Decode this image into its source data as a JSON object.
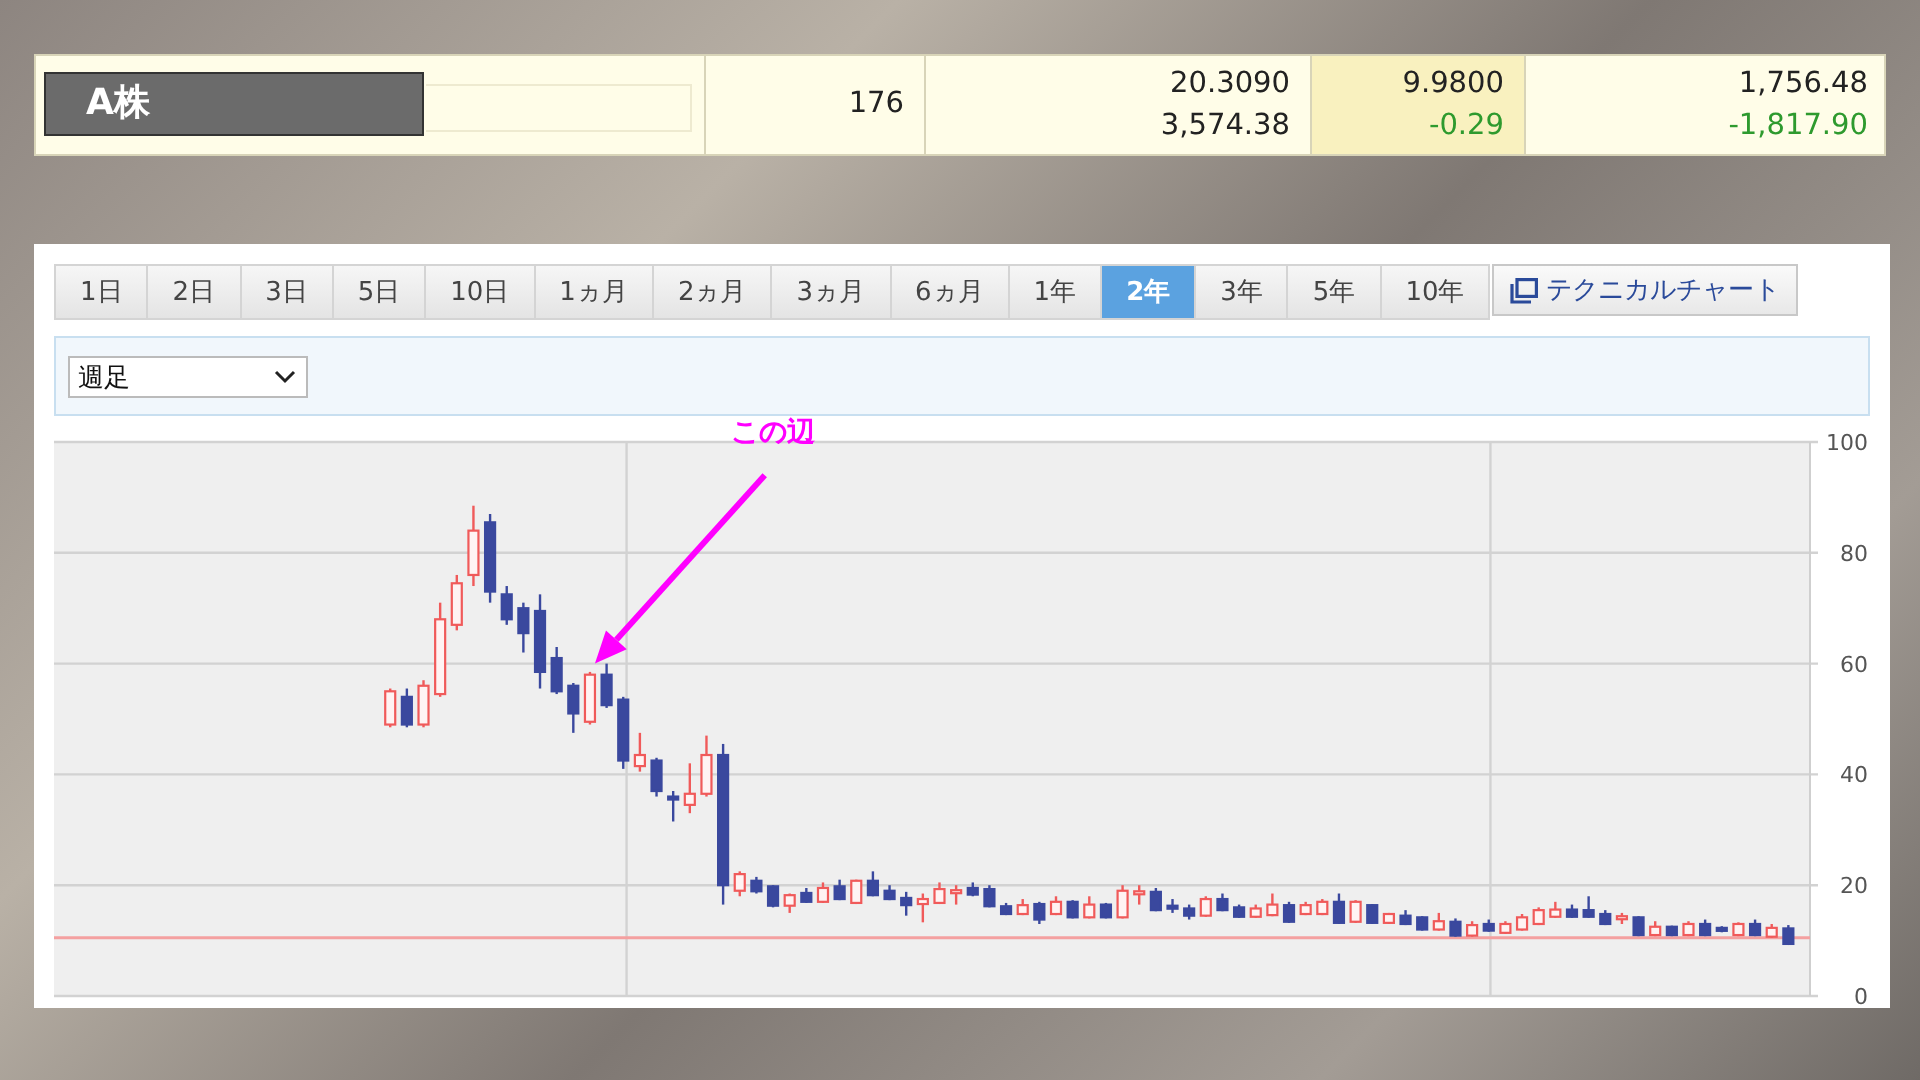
{
  "quote": {
    "name": "A株",
    "cells": [
      {
        "value": "176",
        "highlighted": false
      },
      {
        "value": "20.3090",
        "sub": "3,574.38",
        "highlighted": false
      },
      {
        "value": "9.9800",
        "change": "-0.29",
        "highlighted": true
      },
      {
        "value": "1,756.48",
        "change": "-1,817.90",
        "highlighted": false
      }
    ]
  },
  "period_tabs": [
    {
      "label": "1日",
      "selected": false
    },
    {
      "label": "2日",
      "selected": false
    },
    {
      "label": "3日",
      "selected": false
    },
    {
      "label": "5日",
      "selected": false
    },
    {
      "label": "10日",
      "selected": false
    },
    {
      "label": "1ヵ月",
      "selected": false
    },
    {
      "label": "2ヵ月",
      "selected": false
    },
    {
      "label": "3ヵ月",
      "selected": false
    },
    {
      "label": "6ヵ月",
      "selected": false
    },
    {
      "label": "1年",
      "selected": false
    },
    {
      "label": "2年",
      "selected": true
    },
    {
      "label": "3年",
      "selected": false
    },
    {
      "label": "5年",
      "selected": false
    },
    {
      "label": "10年",
      "selected": false
    }
  ],
  "technical_chart_button": {
    "label": "テクニカルチャート"
  },
  "interval_select": {
    "value": "週足"
  },
  "chart": {
    "chart_data": {
      "type": "candlestick",
      "ylim": [
        0,
        100
      ],
      "yticks": [
        0,
        20,
        40,
        60,
        80,
        100
      ],
      "grid": true,
      "annotations": [
        "この辺"
      ],
      "ohlc": [
        [
          49,
          55.5,
          48.5,
          55
        ],
        [
          54,
          55.5,
          48.5,
          49
        ],
        [
          49,
          57,
          48.5,
          56
        ],
        [
          54.5,
          71,
          54,
          68
        ],
        [
          67,
          76,
          66,
          74.5
        ],
        [
          76,
          88.5,
          74,
          84
        ],
        [
          85.5,
          87,
          71,
          73
        ],
        [
          72.5,
          74,
          67,
          68
        ],
        [
          70,
          71,
          62,
          65.5
        ],
        [
          69.5,
          72.5,
          55.5,
          58.5
        ],
        [
          61,
          63,
          54.5,
          55
        ],
        [
          56,
          56.5,
          47.5,
          51
        ],
        [
          49.5,
          58.5,
          49,
          58
        ],
        [
          58,
          60,
          52,
          52.5
        ],
        [
          53.5,
          54,
          41,
          42.5
        ],
        [
          41.5,
          47.5,
          40.5,
          43.5
        ],
        [
          42.5,
          43,
          36,
          37
        ],
        [
          36,
          37,
          31.5,
          35.5
        ],
        [
          34.5,
          42,
          33,
          36.5
        ],
        [
          36.5,
          47,
          36,
          43.5
        ],
        [
          43.5,
          45.5,
          16.5,
          20
        ],
        [
          19,
          22.5,
          18,
          22
        ],
        [
          20.8,
          21.5,
          18.5,
          18.9
        ],
        [
          19.8,
          20,
          16,
          16.3
        ],
        [
          16.3,
          18.5,
          15,
          18.2
        ],
        [
          18.6,
          19.5,
          16.8,
          17
        ],
        [
          17,
          20.5,
          16.8,
          19.5
        ],
        [
          19.8,
          21,
          17.3,
          17.5
        ],
        [
          16.8,
          21,
          16.6,
          20.8
        ],
        [
          20.8,
          22.5,
          18,
          18.2
        ],
        [
          19,
          20,
          17.3,
          17.5
        ],
        [
          17.7,
          18.8,
          14.5,
          16.4
        ],
        [
          16.6,
          18.5,
          13.3,
          17.5
        ],
        [
          16.8,
          20.5,
          16.6,
          19.3
        ],
        [
          18.8,
          20,
          16.5,
          19.1
        ],
        [
          19.5,
          20.5,
          18,
          18.3
        ],
        [
          19.3,
          20,
          16,
          16.2
        ],
        [
          16.2,
          16.8,
          14.6,
          14.8
        ],
        [
          14.8,
          17.5,
          14.6,
          16.4
        ],
        [
          16.6,
          17,
          13,
          13.8
        ],
        [
          14.8,
          18,
          14.6,
          17
        ],
        [
          17,
          17.3,
          14,
          14.2
        ],
        [
          14.2,
          18,
          14,
          16.5
        ],
        [
          16.5,
          16.8,
          14,
          14.2
        ],
        [
          14.2,
          20,
          14,
          19
        ],
        [
          18.5,
          20,
          16.5,
          18.9
        ],
        [
          18.8,
          19.5,
          15.3,
          15.5
        ],
        [
          16.3,
          17.5,
          15,
          15.8
        ],
        [
          15.8,
          16.5,
          13.8,
          14.5
        ],
        [
          14.5,
          18,
          14.3,
          17.5
        ],
        [
          17.5,
          18.5,
          15.3,
          15.5
        ],
        [
          16,
          16.5,
          14.1,
          14.3
        ],
        [
          14.3,
          16.5,
          14.1,
          15.8
        ],
        [
          14.6,
          18.5,
          14.4,
          16.5
        ],
        [
          16.4,
          17,
          13.2,
          13.4
        ],
        [
          14.8,
          17,
          14.6,
          16.4
        ],
        [
          14.8,
          17.5,
          14.6,
          17
        ],
        [
          17,
          18.5,
          13,
          13.2
        ],
        [
          13.4,
          17.3,
          13.2,
          17
        ],
        [
          16.4,
          16.6,
          13,
          13.2
        ],
        [
          13.2,
          15,
          13,
          14.8
        ],
        [
          14.5,
          15.5,
          12.8,
          13
        ],
        [
          14.2,
          14.4,
          11.8,
          12
        ],
        [
          12,
          15,
          11.8,
          13.5
        ],
        [
          13.4,
          14,
          10.7,
          10.9
        ],
        [
          10.9,
          13.5,
          10.7,
          12.8
        ],
        [
          13,
          13.8,
          11.6,
          11.8
        ],
        [
          11.4,
          13.5,
          11.2,
          13
        ],
        [
          12,
          14.8,
          11.8,
          14.2
        ],
        [
          13,
          16,
          12.8,
          15.5
        ],
        [
          14.3,
          17,
          14.1,
          15.6
        ],
        [
          15.6,
          16.5,
          14.1,
          14.3
        ],
        [
          15.5,
          18,
          14.1,
          14.3
        ],
        [
          14.8,
          15.5,
          12.8,
          13
        ],
        [
          13.9,
          15,
          13,
          14.4
        ],
        [
          14.2,
          14.4,
          10.8,
          11
        ],
        [
          11,
          13.5,
          10.8,
          12.5
        ],
        [
          12.5,
          12.7,
          10.8,
          11
        ],
        [
          11,
          13.5,
          10.8,
          13
        ],
        [
          13,
          13.8,
          10.8,
          11
        ],
        [
          12.3,
          12.6,
          11.5,
          11.8
        ],
        [
          11,
          13.3,
          10.8,
          13
        ],
        [
          13,
          13.8,
          10.8,
          11
        ],
        [
          10.7,
          13,
          10.5,
          12.3
        ],
        [
          12.2,
          12.8,
          9.2,
          9.4
        ]
      ],
      "ref_lines": [
        {
          "axis": "y",
          "value": 10.5,
          "color": "#f4a0a0"
        }
      ]
    }
  }
}
